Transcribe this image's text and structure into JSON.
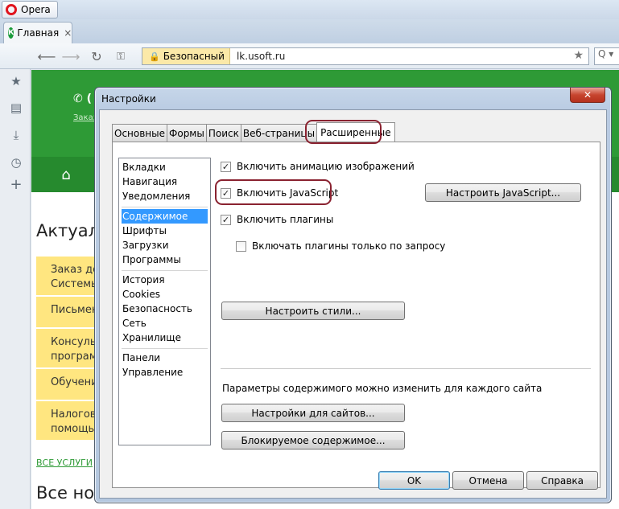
{
  "browser": {
    "menu_label": "Opera",
    "tab_title": "Главная",
    "tab_close": "×",
    "security_label": "Безопасный",
    "url": "lk.usoft.ru",
    "search_placeholder": "Q ▾",
    "side_icons": [
      "star-icon",
      "notes-icon",
      "download-icon",
      "history-icon",
      "add-icon"
    ]
  },
  "webpage": {
    "phone_prefix": "(",
    "order_link": "Заказ",
    "heading": "Актуал",
    "items": [
      {
        "line1": "Заказ до",
        "line2": "Системы"
      },
      {
        "line1": "Письмен",
        "line2": ""
      },
      {
        "line1": "Консульт",
        "line2": "програм"
      },
      {
        "line1": "Обучени",
        "line2": ""
      },
      {
        "line1": "Налогова",
        "line2": "помощь"
      }
    ],
    "all_services": "ВСЕ УСЛУГИ",
    "news_heading": "Все нов"
  },
  "dialog": {
    "title": "Настройки",
    "close_label": "✕",
    "tabs": [
      "Основные",
      "Формы",
      "Поиск",
      "Веб-страницы",
      "Расширенные"
    ],
    "active_tab": "Расширенные",
    "categories": [
      [
        "Вкладки",
        "Навигация",
        "Уведомления"
      ],
      [
        "Содержимое",
        "Шрифты",
        "Загрузки",
        "Программы"
      ],
      [
        "История",
        "Cookies",
        "Безопасность",
        "Сеть",
        "Хранилище"
      ],
      [
        "Панели",
        "Управление"
      ]
    ],
    "selected_category": "Содержимое",
    "options": {
      "animate_images": {
        "label": "Включить анимацию изображений",
        "checked": true
      },
      "javascript": {
        "label": "Включить JavaScript",
        "checked": true
      },
      "plugins": {
        "label": "Включить плагины",
        "checked": true
      },
      "plugins_on_demand": {
        "label": "Включать плагины только по запросу",
        "checked": false
      }
    },
    "buttons": {
      "configure_js": "Настроить JavaScript...",
      "configure_styles": "Настроить стили...",
      "site_settings": "Настройки для сайтов...",
      "blocked_content": "Блокируемое содержимое...",
      "ok": "OK",
      "cancel": "Отмена",
      "help": "Справка"
    },
    "site_hint": "Параметры содержимого можно изменить для каждого сайта",
    "check_mark": "✓",
    "highlight_color": "#8a2230"
  }
}
